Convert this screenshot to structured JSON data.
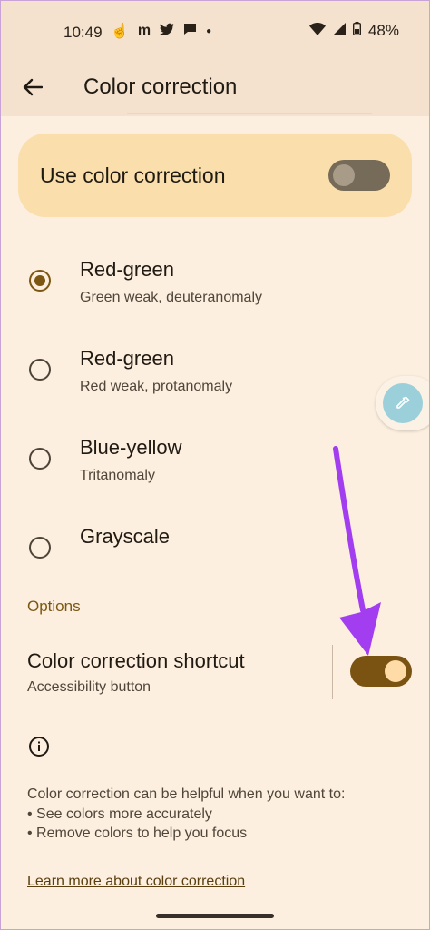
{
  "status_bar": {
    "time": "10:49",
    "battery": "48%",
    "left_icons": [
      "gesture-icon",
      "m-icon",
      "twitter-icon",
      "message-icon",
      "dot-icon"
    ],
    "right_icons": [
      "wifi-icon",
      "signal-icon",
      "battery-icon"
    ]
  },
  "app_bar": {
    "title": "Color correction"
  },
  "main_toggle": {
    "label": "Use color correction",
    "on": false
  },
  "modes": [
    {
      "title": "Red-green",
      "subtitle": "Green weak, deuteranomaly",
      "selected": true
    },
    {
      "title": "Red-green",
      "subtitle": "Red weak, protanomaly",
      "selected": false
    },
    {
      "title": "Blue-yellow",
      "subtitle": "Tritanomaly",
      "selected": false
    },
    {
      "title": "Grayscale",
      "subtitle": "",
      "selected": false
    }
  ],
  "options": {
    "header": "Options",
    "shortcut_title": "Color correction shortcut",
    "shortcut_subtitle": "Accessibility button",
    "shortcut_on": true
  },
  "info": {
    "lines": [
      "Color correction can be helpful when you want to:",
      "• See colors more accurately",
      "• Remove colors to help you focus"
    ]
  },
  "learn_more": "Learn more about color correction",
  "colors": {
    "background": "#fcefdf",
    "accent": "#7b5712",
    "card": "#fadfad",
    "annotation_arrow": "#a23df0"
  }
}
